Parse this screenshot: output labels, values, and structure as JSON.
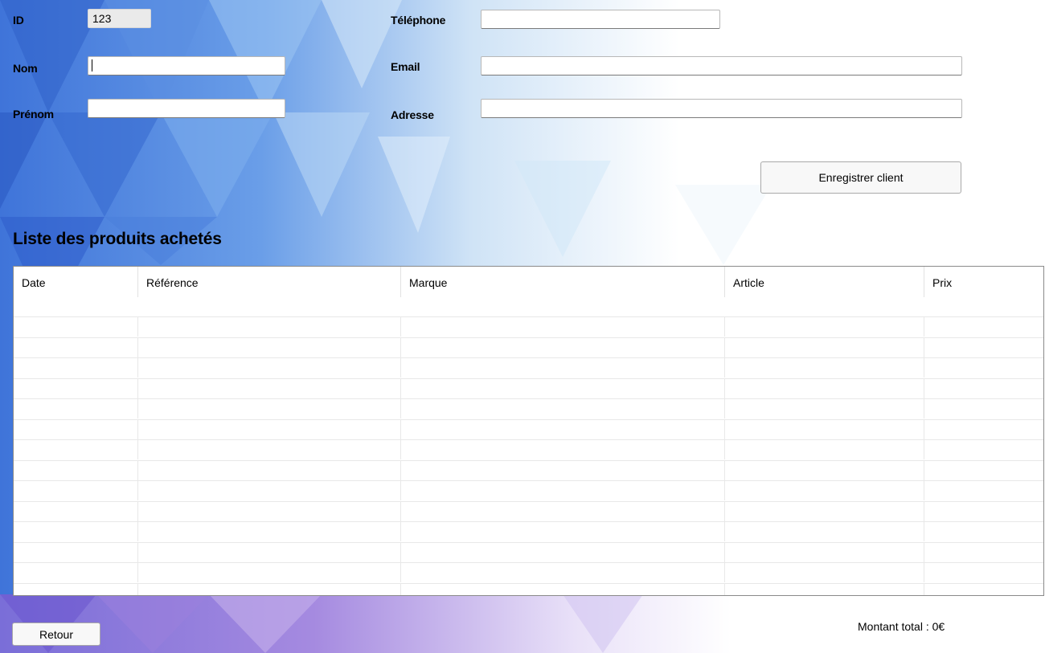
{
  "form": {
    "id_label": "ID",
    "id_value": "123",
    "nom_label": "Nom",
    "nom_value": "",
    "prenom_label": "Prénom",
    "prenom_value": "",
    "telephone_label": "Téléphone",
    "telephone_value": "",
    "email_label": "Email",
    "email_value": "",
    "adresse_label": "Adresse",
    "adresse_value": "",
    "save_button": "Enregistrer client"
  },
  "products": {
    "title": "Liste des produits achetés",
    "columns": [
      "Date",
      "Référence",
      "Marque",
      "Article",
      "Prix"
    ],
    "rows": []
  },
  "footer": {
    "back_button": "Retour",
    "total_label": "Montant total : 0€"
  },
  "colors": {
    "background_blue": "#3b6fd6",
    "background_purple": "#8a6fd8",
    "grid_border": "#8a8a8a",
    "field_readonly": "#eaeaea"
  }
}
